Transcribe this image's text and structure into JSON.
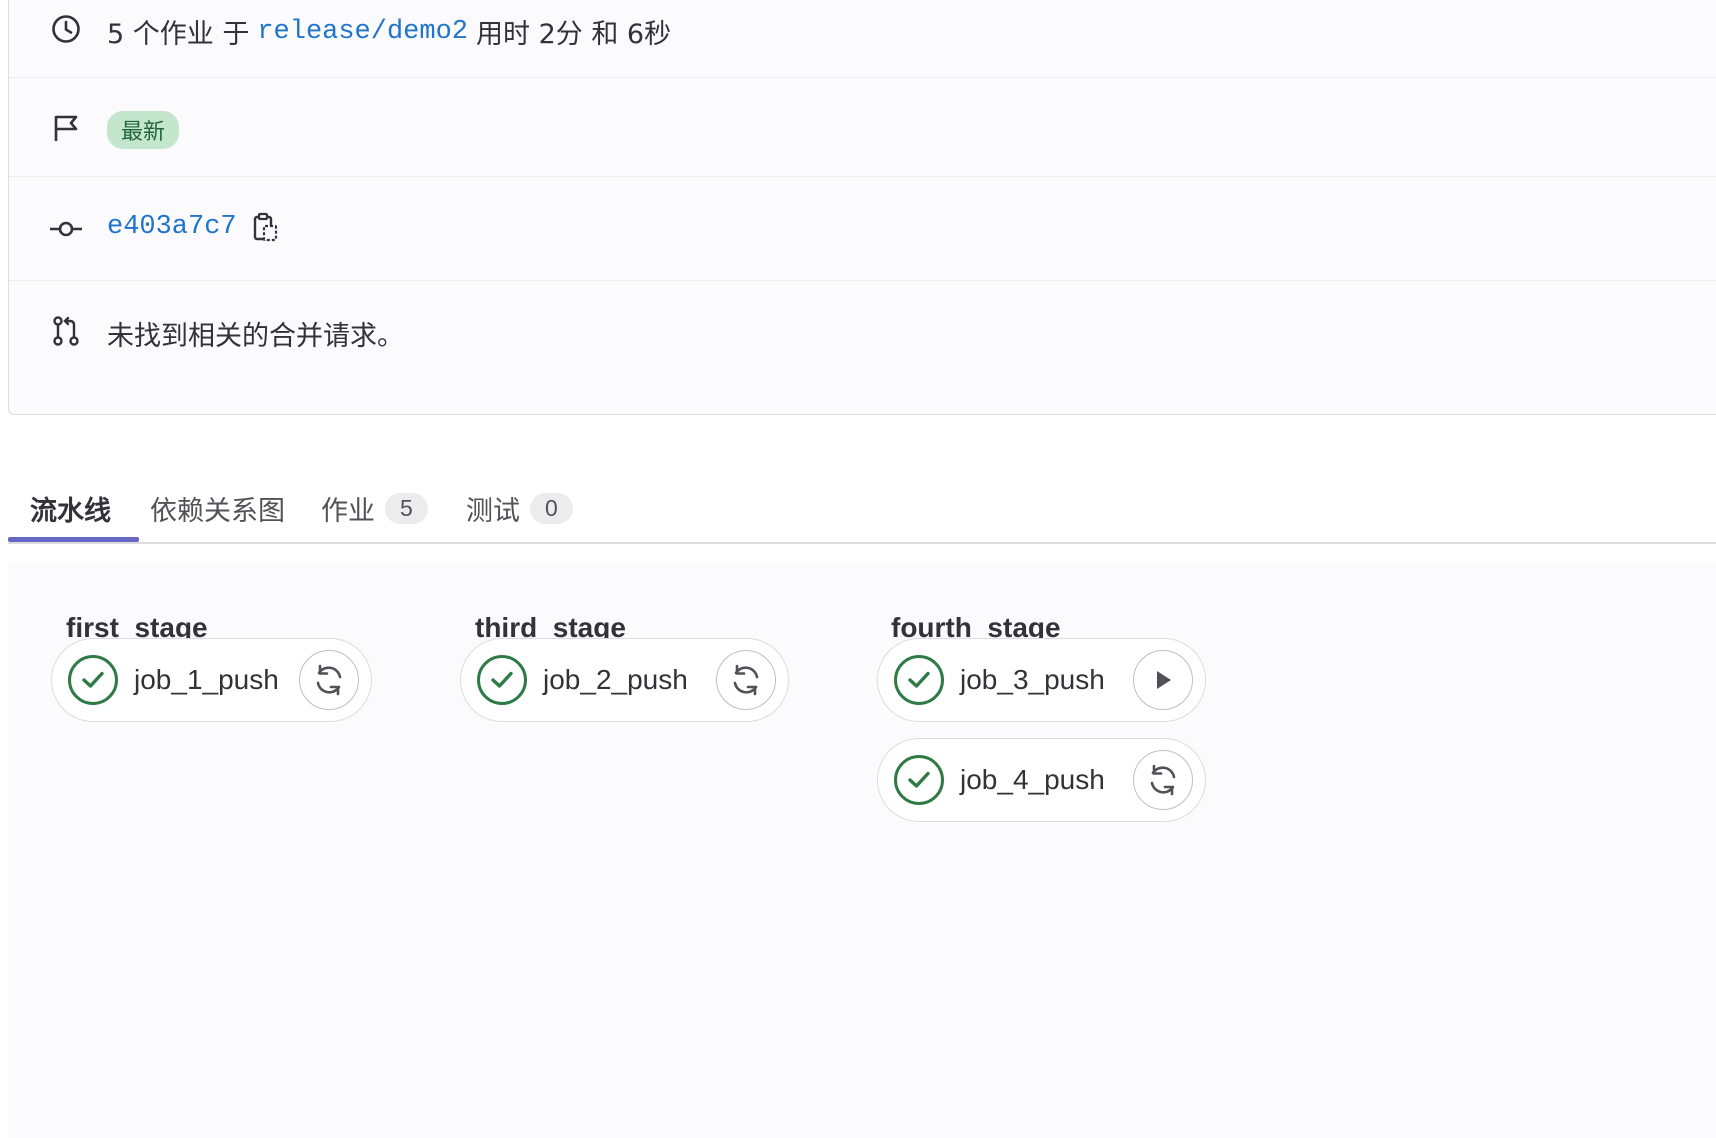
{
  "summary": {
    "duration_prefix": "5 个作业 于",
    "branch": "release/demo2",
    "duration_suffix": "用时 2分 和 6秒",
    "badge_latest": "最新",
    "commit_sha": "e403a7c7",
    "merge_request_text": "未找到相关的合并请求。"
  },
  "icons": {
    "clock": "clock-icon",
    "flag": "flag-icon",
    "commit": "commit-icon",
    "copy": "copy-to-clipboard-icon",
    "merge_request": "merge-request-icon",
    "status_success": "check-circle-icon",
    "retry": "retry-icon",
    "play": "play-icon"
  },
  "tabs": [
    {
      "label": "流水线",
      "active": true
    },
    {
      "label": "依赖关系图"
    },
    {
      "label": "作业",
      "count": "5"
    },
    {
      "label": "测试",
      "count": "0"
    }
  ],
  "stages": [
    {
      "name": "first_stage",
      "jobs": [
        {
          "name": "job_1_push",
          "status": "success",
          "action": "retry"
        }
      ]
    },
    {
      "name": "third_stage",
      "jobs": [
        {
          "name": "job_2_push",
          "status": "success",
          "action": "retry"
        }
      ]
    },
    {
      "name": "fourth_stage",
      "jobs": [
        {
          "name": "job_3_push",
          "status": "success",
          "action": "play"
        },
        {
          "name": "job_4_push",
          "status": "success",
          "action": "retry"
        }
      ]
    }
  ],
  "colors": {
    "success": "#2f7b46",
    "link": "#1f75cb",
    "badge_bg": "#c3e6cd",
    "tab_underline": "#6666c4"
  }
}
